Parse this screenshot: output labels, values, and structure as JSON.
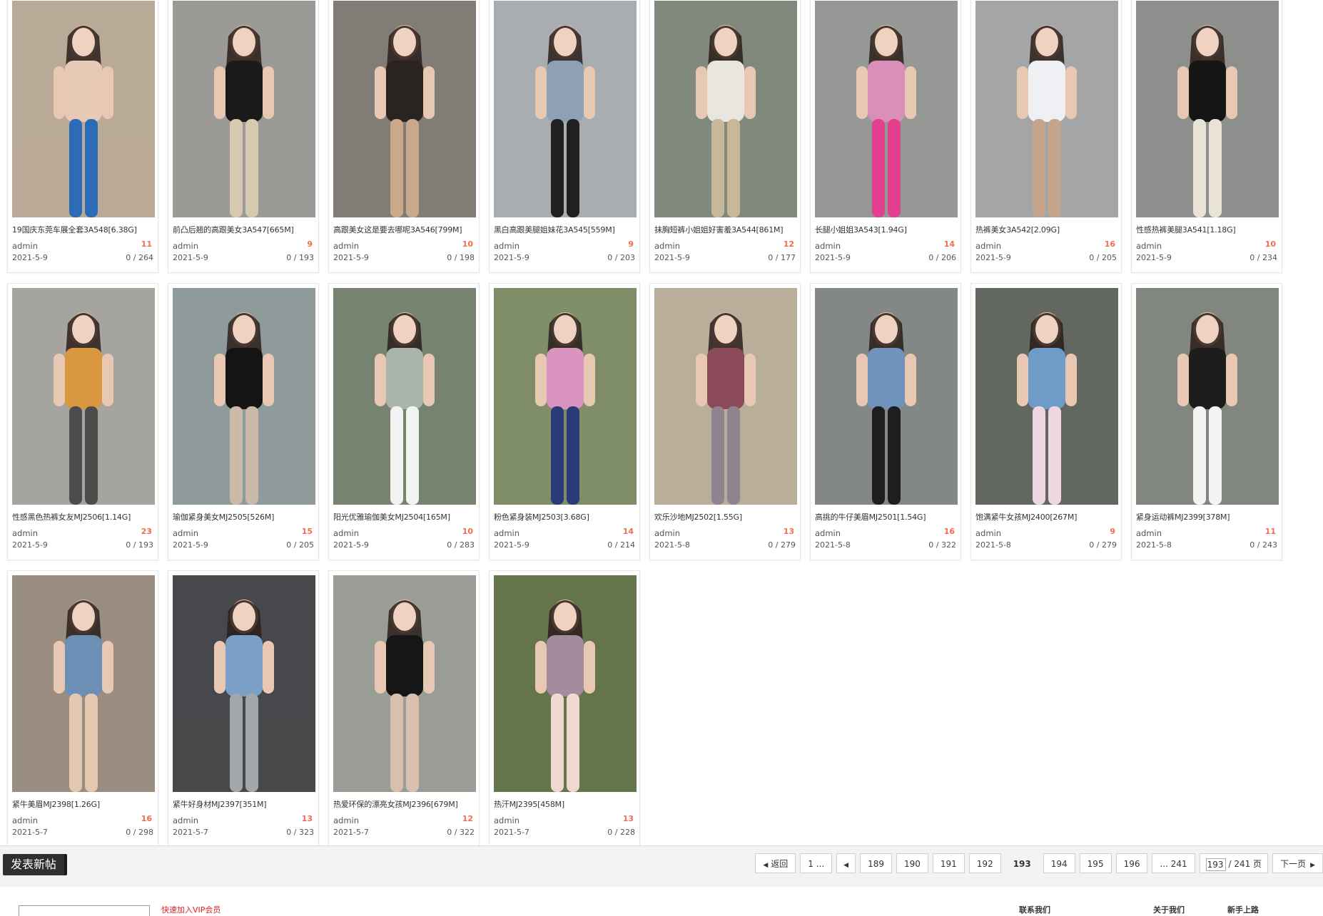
{
  "posts": [
    {
      "title": "19国庆东莞车展全套3A548[6.38G]",
      "author": "admin",
      "count": "11",
      "date": "2021-5-9",
      "stats": "0 / 264",
      "thumb": {
        "bg": "#c9b8a4",
        "figure": "#e7c9b5",
        "accent": "#2b6bb8"
      }
    },
    {
      "title": "前凸后翘的高跟美女3A547[665M]",
      "author": "admin",
      "count": "9",
      "date": "2021-5-9",
      "stats": "0 / 193",
      "thumb": {
        "bg": "#a9a8a3",
        "figure": "#1a1a1a",
        "accent": "#d7c8b0"
      }
    },
    {
      "title": "高跟美女这是要去哪呢3A546[799M]",
      "author": "admin",
      "count": "10",
      "date": "2021-5-9",
      "stats": "0 / 198",
      "thumb": {
        "bg": "#8d8781",
        "figure": "#2a2420",
        "accent": "#c9a98a"
      }
    },
    {
      "title": "黑白高跟美腿姐妹花3A545[559M]",
      "author": "admin",
      "count": "9",
      "date": "2021-5-9",
      "stats": "0 / 203",
      "thumb": {
        "bg": "#b9bcbf",
        "figure": "#8ea1b4",
        "accent": "#202020"
      }
    },
    {
      "title": "抹胸短裤小姐姐好害羞3A544[861M]",
      "author": "admin",
      "count": "12",
      "date": "2021-5-9",
      "stats": "0 / 177",
      "thumb": {
        "bg": "#8c9587",
        "figure": "#e9e6df",
        "accent": "#c8b89a"
      }
    },
    {
      "title": "长腿小姐姐3A543[1.94G]",
      "author": "admin",
      "count": "14",
      "date": "2021-5-9",
      "stats": "0 / 206",
      "thumb": {
        "bg": "#a3a5a3",
        "figure": "#d98fb8",
        "accent": "#e23f8f"
      }
    },
    {
      "title": "热裤美女3A542[2.09G]",
      "author": "admin",
      "count": "16",
      "date": "2021-5-9",
      "stats": "0 / 205",
      "thumb": {
        "bg": "#b2b3b5",
        "figure": "#eef0f4",
        "accent": "#c5a48c"
      }
    },
    {
      "title": "性感热裤美腿3A541[1.18G]",
      "author": "admin",
      "count": "10",
      "date": "2021-5-9",
      "stats": "0 / 234",
      "thumb": {
        "bg": "#9a9c98",
        "figure": "#151515",
        "accent": "#e9e2d6"
      }
    },
    {
      "title": "性感黑色热裤女友MJ2506[1.14G]",
      "author": "admin",
      "count": "23",
      "date": "2021-5-9",
      "stats": "0 / 193",
      "thumb": {
        "bg": "#b4b2ad",
        "figure": "#d99840",
        "accent": "#4c4c4c"
      }
    },
    {
      "title": "瑜伽紧身美女MJ2505[526M]",
      "author": "admin",
      "count": "15",
      "date": "2021-5-9",
      "stats": "0 / 205",
      "thumb": {
        "bg": "#9ca8a8",
        "figure": "#141414",
        "accent": "#cbb9a9"
      }
    },
    {
      "title": "阳光优雅瑜伽美女MJ2504[165M]",
      "author": "admin",
      "count": "10",
      "date": "2021-5-9",
      "stats": "0 / 283",
      "thumb": {
        "bg": "#7f8f7a",
        "figure": "#a9b4ad",
        "accent": "#f2f2f2"
      }
    },
    {
      "title": "粉色紧身装MJ2503[3.68G]",
      "author": "admin",
      "count": "14",
      "date": "2021-5-9",
      "stats": "0 / 214",
      "thumb": {
        "bg": "#8a9b72",
        "figure": "#d995c0",
        "accent": "#2a3b7a"
      }
    },
    {
      "title": "欢乐沙地MJ2502[1.55G]",
      "author": "admin",
      "count": "13",
      "date": "2021-5-8",
      "stats": "0 / 279",
      "thumb": {
        "bg": "#c8bda8",
        "figure": "#8a4a5a",
        "accent": "#8e8490"
      }
    },
    {
      "title": "高挑的牛仔美眉MJ2501[1.54G]",
      "author": "admin",
      "count": "16",
      "date": "2021-5-8",
      "stats": "0 / 322",
      "thumb": {
        "bg": "#8f9392",
        "figure": "#6f93bd",
        "accent": "#1e1e1e"
      }
    },
    {
      "title": "饱满紧牛女孩MJ2400[267M]",
      "author": "admin",
      "count": "9",
      "date": "2021-5-8",
      "stats": "0 / 279",
      "thumb": {
        "bg": "#6b7168",
        "figure": "#6f9bc9",
        "accent": "#efd7e2"
      }
    },
    {
      "title": "紧身运动裤MJ2399[378M]",
      "author": "admin",
      "count": "11",
      "date": "2021-5-8",
      "stats": "0 / 243",
      "thumb": {
        "bg": "#8c9289",
        "figure": "#1d1d1d",
        "accent": "#f4f4f4"
      }
    },
    {
      "title": "紧牛美眉MJ2398[1.26G]",
      "author": "admin",
      "count": "16",
      "date": "2021-5-7",
      "stats": "0 / 298",
      "thumb": {
        "bg": "#a69a8c",
        "figure": "#6b8fb5",
        "accent": "#e3c7ae"
      }
    },
    {
      "title": "紧牛好身材MJ2397[351M]",
      "author": "admin",
      "count": "13",
      "date": "2021-5-7",
      "stats": "0 / 323",
      "thumb": {
        "bg": "#4d4f52",
        "figure": "#7aa0c8",
        "accent": "#a3a7ab"
      }
    },
    {
      "title": "热爱环保的漂亮女孩MJ2396[679M]",
      "author": "admin",
      "count": "12",
      "date": "2021-5-7",
      "stats": "0 / 322",
      "thumb": {
        "bg": "#a6aba3",
        "figure": "#161616",
        "accent": "#d8bfae"
      }
    },
    {
      "title": "热汗MJ2395[458M]",
      "author": "admin",
      "count": "13",
      "date": "2021-5-7",
      "stats": "0 / 228",
      "thumb": {
        "bg": "#6d7f52",
        "figure": "#a38c9e",
        "accent": "#f0d9cf"
      }
    }
  ],
  "toolbar": {
    "new_post_label": "发表新帖"
  },
  "pagination": {
    "back_label": "返回",
    "first_label": "1 ...",
    "pages": [
      "189",
      "190",
      "191",
      "192",
      "193",
      "194",
      "195",
      "196"
    ],
    "current": "193",
    "last_label": "... 241",
    "jump_value": "193",
    "total_label": "/ 241 页",
    "next_label": "下一页"
  },
  "footer": {
    "notice": "快速加入VIP会员",
    "links": [
      "联系我们",
      "关于我们",
      "新手上路"
    ]
  }
}
